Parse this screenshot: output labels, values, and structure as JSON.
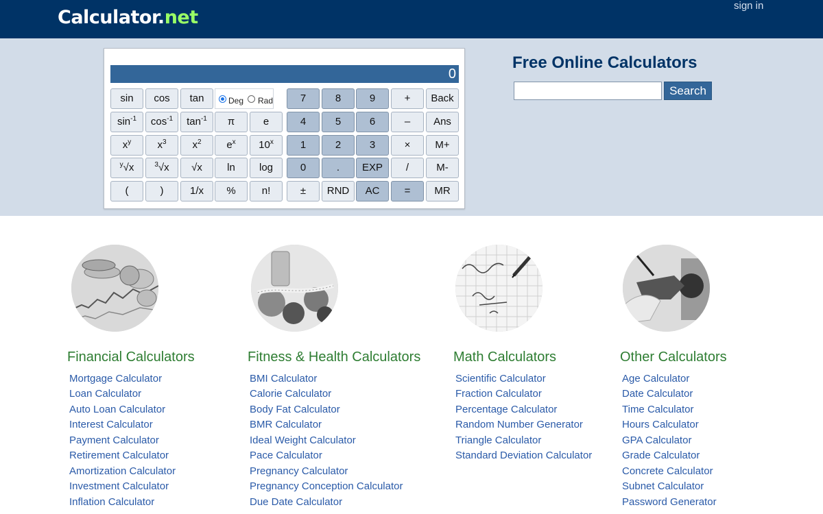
{
  "header": {
    "logo_main": "Calculator",
    "logo_dot": ".",
    "logo_net": "net",
    "signin_label": "sign in"
  },
  "calculator": {
    "display_value": "0",
    "angle_mode": {
      "deg_label": "Deg",
      "rad_label": "Rad",
      "selected": "Deg"
    }
  },
  "search": {
    "title": "Free Online Calculators",
    "button_label": "Search",
    "value": ""
  },
  "categories": [
    {
      "title": "Financial Calculators",
      "image_icon": "coins-chart-image",
      "links": [
        "Mortgage Calculator",
        "Loan Calculator",
        "Auto Loan Calculator",
        "Interest Calculator",
        "Payment Calculator",
        "Retirement Calculator",
        "Amortization Calculator",
        "Investment Calculator",
        "Inflation Calculator"
      ]
    },
    {
      "title": "Fitness & Health Calculators",
      "image_icon": "fruit-tape-measure-image",
      "links": [
        "BMI Calculator",
        "Calorie Calculator",
        "Body Fat Calculator",
        "BMR Calculator",
        "Ideal Weight Calculator",
        "Pace Calculator",
        "Pregnancy Calculator",
        "Pregnancy Conception Calculator",
        "Due Date Calculator"
      ]
    },
    {
      "title": "Math Calculators",
      "image_icon": "math-paper-image",
      "links": [
        "Scientific Calculator",
        "Fraction Calculator",
        "Percentage Calculator",
        "Random Number Generator",
        "Triangle Calculator",
        "Standard Deviation Calculator"
      ]
    },
    {
      "title": "Other Calculators",
      "image_icon": "fuel-pump-image",
      "links": [
        "Age Calculator",
        "Date Calculator",
        "Time Calculator",
        "Hours Calculator",
        "GPA Calculator",
        "Grade Calculator",
        "Concrete Calculator",
        "Subnet Calculator",
        "Password Generator"
      ]
    }
  ],
  "colors": {
    "header_bg": "#003366",
    "band_bg": "#d2dce8",
    "display_bg": "#336699",
    "category_title": "#2e7d32",
    "link": "#2a5aa8"
  }
}
